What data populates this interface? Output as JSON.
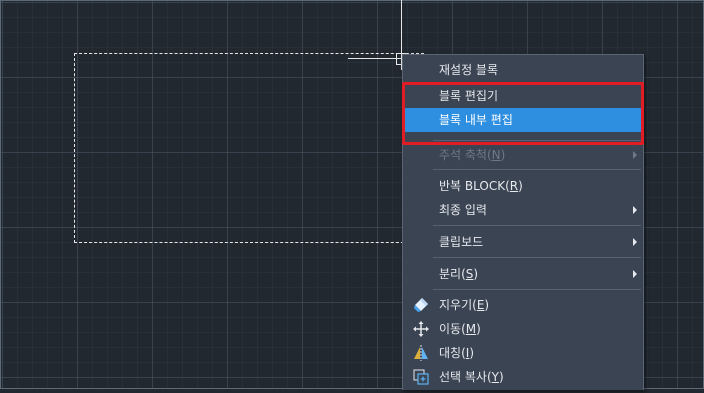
{
  "menu": {
    "items": [
      {
        "label": "재설정 블록",
        "mnemonic": ""
      },
      {
        "label": "블록 편집기",
        "mnemonic": ""
      },
      {
        "label": "블록 내부 편집",
        "mnemonic": ""
      },
      {
        "label": "주석 축척",
        "mnemonic": "N"
      },
      {
        "label": "반복 BLOCK",
        "mnemonic": "R"
      },
      {
        "label": "최종 입력",
        "mnemonic": ""
      },
      {
        "label": "클립보드",
        "mnemonic": ""
      },
      {
        "label": "분리",
        "mnemonic": "S"
      },
      {
        "label": "지우기",
        "mnemonic": "E",
        "icon": "eraser-icon"
      },
      {
        "label": "이동",
        "mnemonic": "M",
        "icon": "move-icon"
      },
      {
        "label": "대칭",
        "mnemonic": "I",
        "icon": "mirror-icon"
      },
      {
        "label": "선택 복사",
        "mnemonic": "Y",
        "icon": "copy-selection-icon"
      }
    ],
    "highlighted_item": "블록 내부 편집",
    "disabled_item": "주석 축척",
    "submenu_items": [
      "주석 축척",
      "최종 입력",
      "클립보드",
      "분리"
    ]
  },
  "colors": {
    "canvas_background": "#212830",
    "menu_background": "#3b4452",
    "highlight": "#2e8fe0",
    "callout_border": "#e21c24"
  }
}
